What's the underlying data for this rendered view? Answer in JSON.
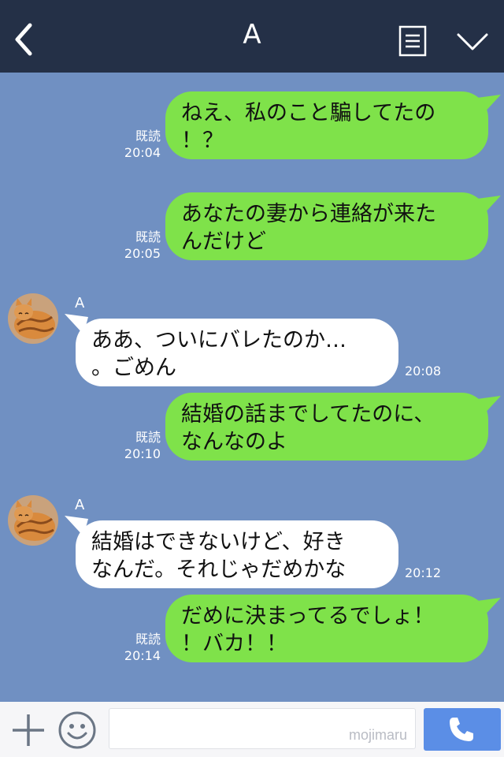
{
  "header": {
    "title": "A",
    "back_icon": "chevron-left-icon",
    "menu_icon": "notes-icon",
    "more_icon": "chevron-down-icon",
    "background": "#243047"
  },
  "chat": {
    "background": "#7090c2",
    "outgoing_bubble_color": "#7fe24a",
    "incoming_bubble_color": "#ffffff",
    "messages": [
      {
        "direction": "out",
        "lines": [
          "ねえ、私のこと騙してたの",
          "！？"
        ],
        "read_label": "既読",
        "time": "20:04"
      },
      {
        "direction": "out",
        "lines": [
          "あなたの妻から連絡が来た",
          "んだけど"
        ],
        "read_label": "既読",
        "time": "20:05"
      },
      {
        "direction": "in",
        "sender": "A",
        "lines": [
          "ああ、ついにバレたのか…",
          "。ごめん"
        ],
        "time": "20:08"
      },
      {
        "direction": "out",
        "lines": [
          "結婚の話までしてたのに、",
          "なんなのよ"
        ],
        "read_label": "既読",
        "time": "20:10"
      },
      {
        "direction": "in",
        "sender": "A",
        "lines": [
          "結婚はできないけど、好き",
          "なんだ。それじゃだめかな"
        ],
        "time": "20:12"
      },
      {
        "direction": "out",
        "lines": [
          "だめに決まってるでしょ！",
          "！バカ！！"
        ],
        "read_label": "既読",
        "time": "20:14"
      }
    ]
  },
  "input_bar": {
    "plus_icon": "plus-icon",
    "emoji_icon": "smiley-icon",
    "message_value": "",
    "watermark": "mojimaru",
    "call_icon": "phone-icon",
    "call_button_color": "#5b8ee6"
  }
}
